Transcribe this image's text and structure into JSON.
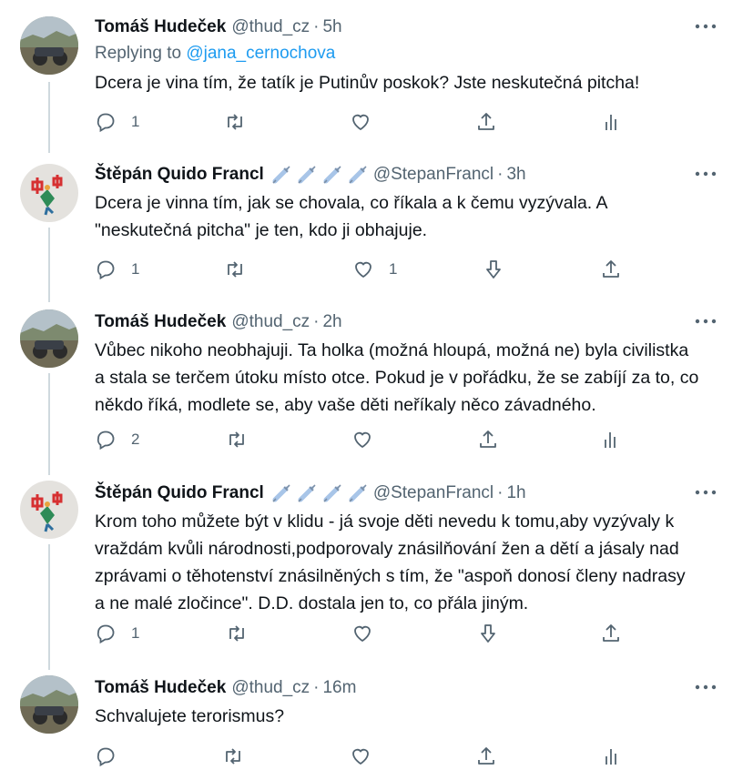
{
  "tweets": [
    {
      "name": "Tomáš Hudeček",
      "handle": "@thud_cz",
      "time": "5h",
      "replying_prefix": "Replying to ",
      "replying_to": "@jana_cernochova",
      "text": "Dcera je vina tím, že tatík je Putinův poskok? Jste neskutečná pitcha!",
      "reply_count": "1",
      "like_count": "",
      "icons": [
        "reply-icon",
        "retweet-icon",
        "like-icon",
        "share-icon",
        "analytics-icon"
      ]
    },
    {
      "name": "Štěpán Quido Francl",
      "handle": "@StepanFrancl",
      "time": "3h",
      "text": "Dcera je vinna tím, jak se chovala, co říkala a k čemu vyzývala. A\n\"neskutečná pitcha\" je ten, kdo ji obhajuje.",
      "reply_count": "1",
      "like_count": "1",
      "icons": [
        "reply-icon",
        "retweet-icon",
        "like-icon",
        "downvote-icon",
        "share-icon"
      ]
    },
    {
      "name": "Tomáš Hudeček",
      "handle": "@thud_cz",
      "time": "2h",
      "text": "Vůbec nikoho neobhajuji. Ta holka (možná hloupá, možná ne) byla civilistka\na stala se terčem útoku místo otce. Pokud je v pořádku, že se zabíjí za to, co\nněkdo říká, modlete se, aby vaše děti neříkaly něco závadného.",
      "reply_count": "2",
      "like_count": "",
      "icons": [
        "reply-icon",
        "retweet-icon",
        "like-icon",
        "share-icon",
        "analytics-icon"
      ]
    },
    {
      "name": "Štěpán Quido Francl",
      "handle": "@StepanFrancl",
      "time": "1h",
      "text": "Krom toho můžete být v klidu - já svoje děti nevedu k tomu,aby vyzývaly k\nvraždám kvůli národnosti,podporovaly znásilňování žen a dětí a jásaly nad\nzprávami o těhotenství znásilněných s tím, že \"aspoň donosí členy nadrasy\na ne malé zločince\". D.D. dostala jen to, co přála jiným.",
      "reply_count": "1",
      "like_count": "",
      "icons": [
        "reply-icon",
        "retweet-icon",
        "like-icon",
        "downvote-icon",
        "share-icon"
      ]
    },
    {
      "name": "Tomáš Hudeček",
      "handle": "@thud_cz",
      "time": "16m",
      "text": "Schvalujete terorismus?",
      "reply_count": "",
      "like_count": "",
      "icons": [
        "reply-icon",
        "retweet-icon",
        "like-icon",
        "share-icon",
        "analytics-icon"
      ]
    }
  ],
  "separator": "·",
  "colors": {
    "text": "#0f1419",
    "secondary": "#536471",
    "link": "#1d9bf0",
    "thread_line": "#cfd9de",
    "syringe_emoji": "#a8c5e8"
  }
}
